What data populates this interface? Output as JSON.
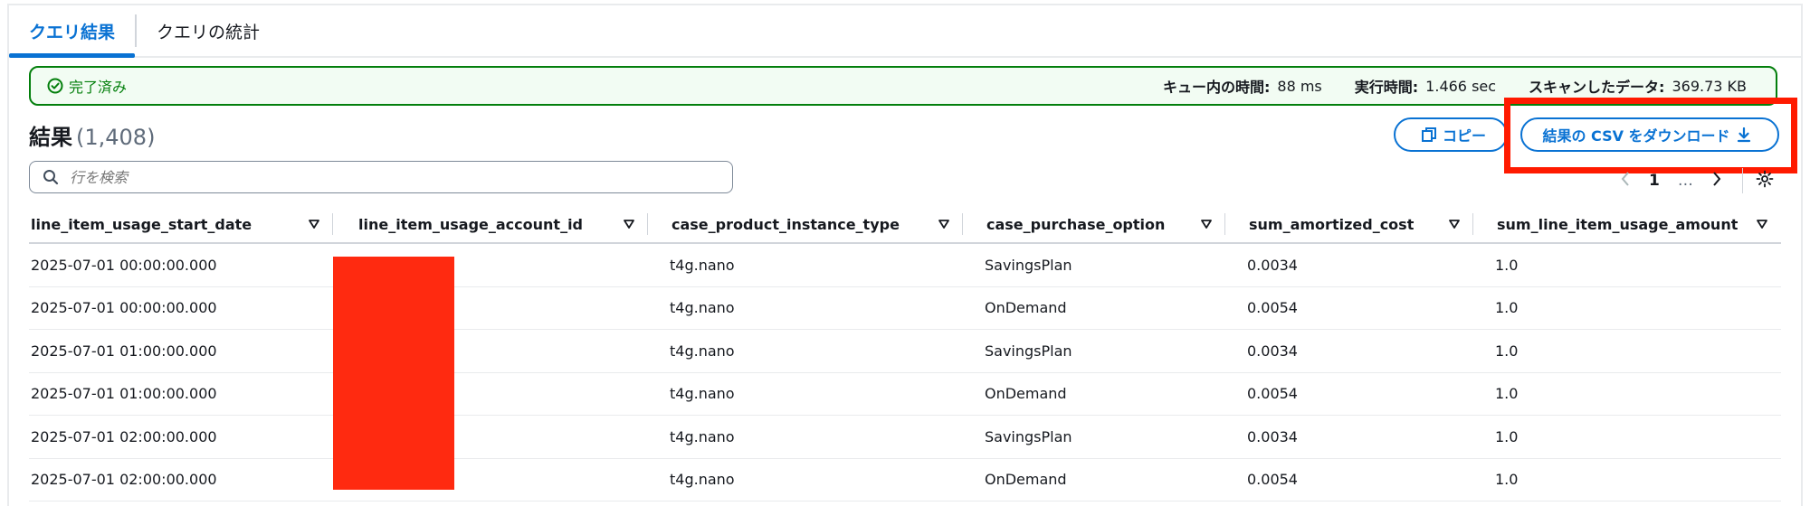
{
  "tabs": [
    {
      "label": "クエリ結果",
      "active": true
    },
    {
      "label": "クエリの統計",
      "active": false
    }
  ],
  "status": {
    "state": "完了済み",
    "metrics": [
      {
        "key": "キュー内の時間:",
        "value": "88 ms"
      },
      {
        "key": "実行時間:",
        "value": "1.466 sec"
      },
      {
        "key": "スキャンしたデータ:",
        "value": "369.73 KB"
      }
    ]
  },
  "results": {
    "title": "結果",
    "count": "(1,408)"
  },
  "actions": {
    "copy_label": "コピー",
    "download_label": "結果の CSV をダウンロード"
  },
  "search": {
    "placeholder": "行を検索"
  },
  "pagination": {
    "current_page": "1",
    "ellipsis": "…"
  },
  "table": {
    "columns": [
      "line_item_usage_start_date",
      "line_item_usage_account_id",
      "case_product_instance_type",
      "case_purchase_option",
      "sum_amortized_cost",
      "sum_line_item_usage_amount"
    ],
    "rows": [
      [
        "2025-07-01 00:00:00.000",
        "",
        "t4g.nano",
        "SavingsPlan",
        "0.0034",
        "1.0"
      ],
      [
        "2025-07-01 00:00:00.000",
        "",
        "t4g.nano",
        "OnDemand",
        "0.0054",
        "1.0"
      ],
      [
        "2025-07-01 01:00:00.000",
        "",
        "t4g.nano",
        "SavingsPlan",
        "0.0034",
        "1.0"
      ],
      [
        "2025-07-01 01:00:00.000",
        "",
        "t4g.nano",
        "OnDemand",
        "0.0054",
        "1.0"
      ],
      [
        "2025-07-01 02:00:00.000",
        "",
        "t4g.nano",
        "SavingsPlan",
        "0.0034",
        "1.0"
      ],
      [
        "2025-07-01 02:00:00.000",
        "",
        "t4g.nano",
        "OnDemand",
        "0.0054",
        "1.0"
      ]
    ]
  },
  "colors": {
    "accent": "#0972d3",
    "success": "#037f0c",
    "redaction": "#ff2a10",
    "highlight": "#ff1a00"
  }
}
